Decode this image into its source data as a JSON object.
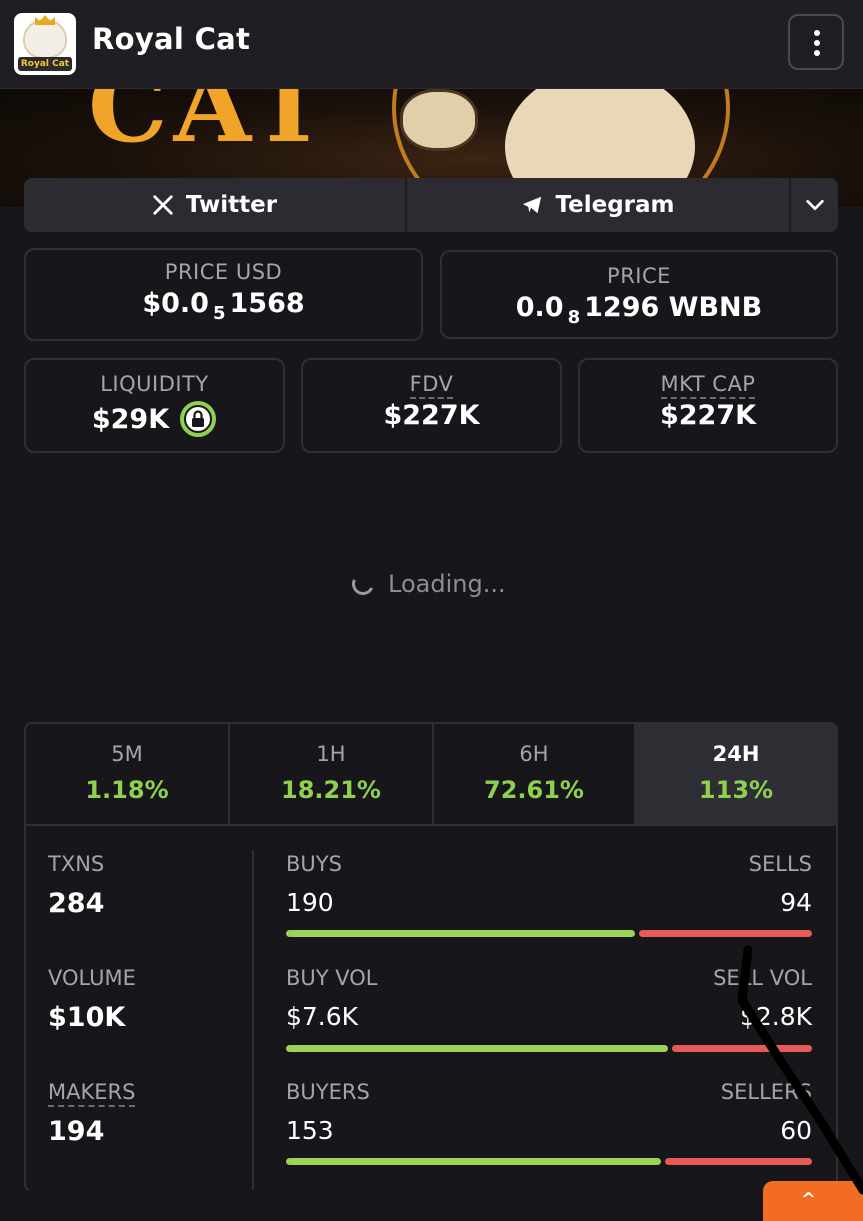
{
  "header": {
    "title": "Royal Cat",
    "logo_text": "Royal Cat",
    "menu_icon": "vertical-dots-icon"
  },
  "socials": {
    "twitter_label": "Twitter",
    "telegram_label": "Telegram",
    "more_icon": "chevron-down-icon"
  },
  "price_usd": {
    "label": "PRICE USD",
    "prefix": "$0.0",
    "zeros": "5",
    "suffix": "1568"
  },
  "price_native": {
    "label": "PRICE",
    "prefix": "0.0",
    "zeros": "8",
    "suffix": "1296 WBNB"
  },
  "metrics": {
    "liquidity": {
      "label": "LIQUIDITY",
      "value": "$29K",
      "icon": "lock-icon"
    },
    "fdv": {
      "label": "FDV",
      "value": "$227K"
    },
    "mkt_cap": {
      "label": "MKT CAP",
      "value": "$227K"
    }
  },
  "chart": {
    "loading_text": "Loading..."
  },
  "tabs": [
    {
      "label": "5M",
      "change": "1.18%"
    },
    {
      "label": "1H",
      "change": "18.21%"
    },
    {
      "label": "6H",
      "change": "72.61%"
    },
    {
      "label": "24H",
      "change": "113%",
      "active": true
    }
  ],
  "txns": {
    "label": "TXNS",
    "value": "284",
    "buys_label": "BUYS",
    "buys": "190",
    "sells_label": "SELLS",
    "sells": "94",
    "buy_fraction": 0.669
  },
  "volume": {
    "label": "VOLUME",
    "value": "$10K",
    "buy_label": "BUY VOL",
    "buy": "$7.6K",
    "sell_label": "SELL VOL",
    "sell": "$2.8K",
    "buy_fraction": 0.731
  },
  "makers": {
    "label": "MAKERS",
    "value": "194",
    "buyers_label": "BUYERS",
    "buyers": "153",
    "sellers_label": "SELLERS",
    "sellers": "60",
    "buy_fraction": 0.718
  },
  "colors": {
    "positive": "#8fd14f",
    "buy_bar": "#9ad25a",
    "sell_bar": "#e85a5a",
    "accent": "#f26d21"
  }
}
